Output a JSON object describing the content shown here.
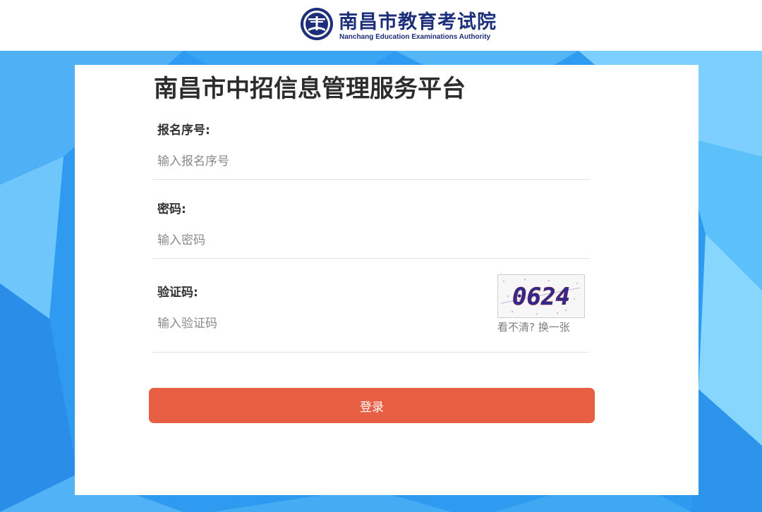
{
  "header": {
    "org_name_cn": "南昌市教育考试院",
    "org_name_en": "Nanchang Education Examinations Authority"
  },
  "login_form": {
    "title": "南昌市中招信息管理服务平台",
    "fields": {
      "reg_no": {
        "label": "报名序号:",
        "placeholder": "输入报名序号"
      },
      "password": {
        "label": "密码:",
        "placeholder": "输入密码"
      },
      "captcha": {
        "label": "验证码:",
        "placeholder": "输入验证码",
        "image_text": "0624",
        "refresh_label": "看不清? 换一张"
      }
    },
    "submit_label": "登录"
  },
  "colors": {
    "accent": "#e75e42",
    "background": "#2f9bf0",
    "brand": "#1d2f7a"
  }
}
